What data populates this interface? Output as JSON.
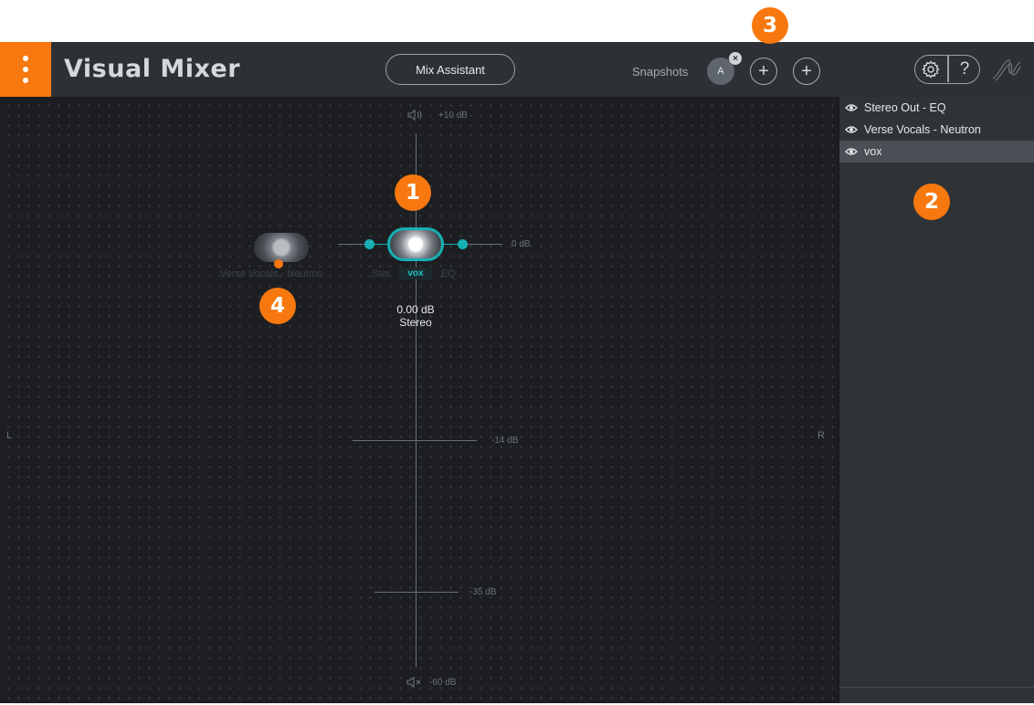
{
  "header": {
    "title": "Visual Mixer",
    "mix_assistant": "Mix Assistant",
    "snapshots_label": "Snapshots",
    "snapshot_a": "A",
    "snapshot_remove": "×",
    "add": "+",
    "help": "?",
    "accent": "#f7780e"
  },
  "canvas": {
    "scale": {
      "top": "+10 dB",
      "zero": "0 dB",
      "mid": "-14 dB",
      "low": "-35 dB",
      "bottom": "-60 dB"
    },
    "left": "L",
    "right": "R",
    "selected_track": {
      "name": "vox",
      "gain": "0.00 dB",
      "width": "Stereo",
      "color": "#17b0b3"
    },
    "ghost_labels": {
      "verse": "Verse Vocals - Neutron",
      "stereo_left": "Ster",
      "eq_right": "EQ"
    }
  },
  "sidebar": {
    "tracks": [
      {
        "label": "Stereo Out - EQ",
        "selected": false
      },
      {
        "label": "Verse Vocals - Neutron",
        "selected": false
      },
      {
        "label": "vox",
        "selected": true
      }
    ]
  },
  "callouts": [
    "1",
    "2",
    "3",
    "4"
  ]
}
